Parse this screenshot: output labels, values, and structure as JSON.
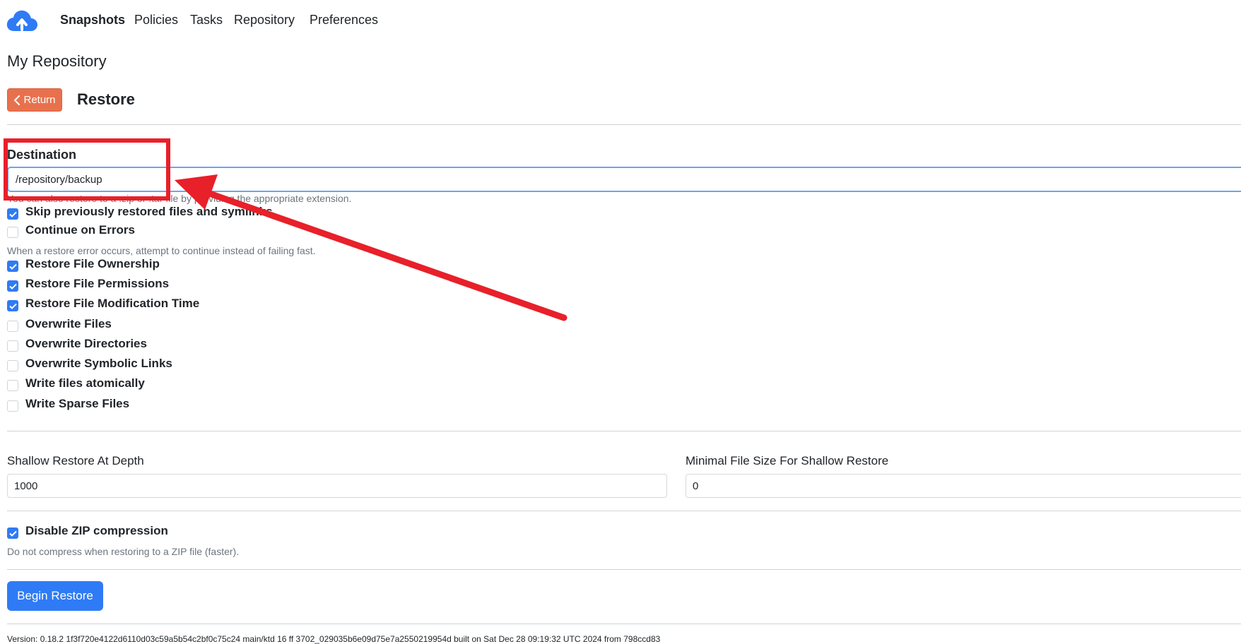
{
  "nav": {
    "items": [
      "Snapshots",
      "Policies",
      "Tasks",
      "Repository",
      "Preferences"
    ],
    "active": "Snapshots",
    "logo_icon": "cloud-upload-icon"
  },
  "repo_title": "My Repository",
  "return_button": {
    "label": "Return",
    "icon": "chevron-left-icon"
  },
  "page_title": "Restore",
  "destination": {
    "label": "Destination",
    "value": "/repository/backup",
    "hint": "You can also restore to a .zip or .tar file by providing the appropriate extension."
  },
  "options": {
    "skip_previously_restored": {
      "label": "Skip previously restored files and symlinks",
      "checked": true
    },
    "continue_on_errors": {
      "label": "Continue on Errors",
      "checked": false,
      "hint": "When a restore error occurs, attempt to continue instead of failing fast."
    },
    "restore_ownership": {
      "label": "Restore File Ownership",
      "checked": true
    },
    "restore_permissions": {
      "label": "Restore File Permissions",
      "checked": true
    },
    "restore_mod_time": {
      "label": "Restore File Modification Time",
      "checked": true
    },
    "overwrite_files": {
      "label": "Overwrite Files",
      "checked": false
    },
    "overwrite_directories": {
      "label": "Overwrite Directories",
      "checked": false
    },
    "overwrite_symlinks": {
      "label": "Overwrite Symbolic Links",
      "checked": false
    },
    "write_atomically": {
      "label": "Write files atomically",
      "checked": false
    },
    "write_sparse": {
      "label": "Write Sparse Files",
      "checked": false
    }
  },
  "shallow": {
    "depth_label": "Shallow Restore At Depth",
    "depth_value": "1000",
    "min_size_label": "Minimal File Size For Shallow Restore",
    "min_size_value": "0"
  },
  "zip": {
    "label": "Disable ZIP compression",
    "checked": true,
    "hint": "Do not compress when restoring to a ZIP file (faster)."
  },
  "begin_button": "Begin Restore",
  "version": "Version: 0.18.2 1f3f720e4122d6110d03c59a5b54c2bf0c75c24 main/ktd   16 ff 3702_029035b6e09d75e7a2550219954d built on Sat Dec 28 09:19:32 UTC 2024 from 798ccd83",
  "colors": {
    "accent": "#2f7bf5",
    "return": "#e8714d",
    "annotation": "#e8202a"
  }
}
